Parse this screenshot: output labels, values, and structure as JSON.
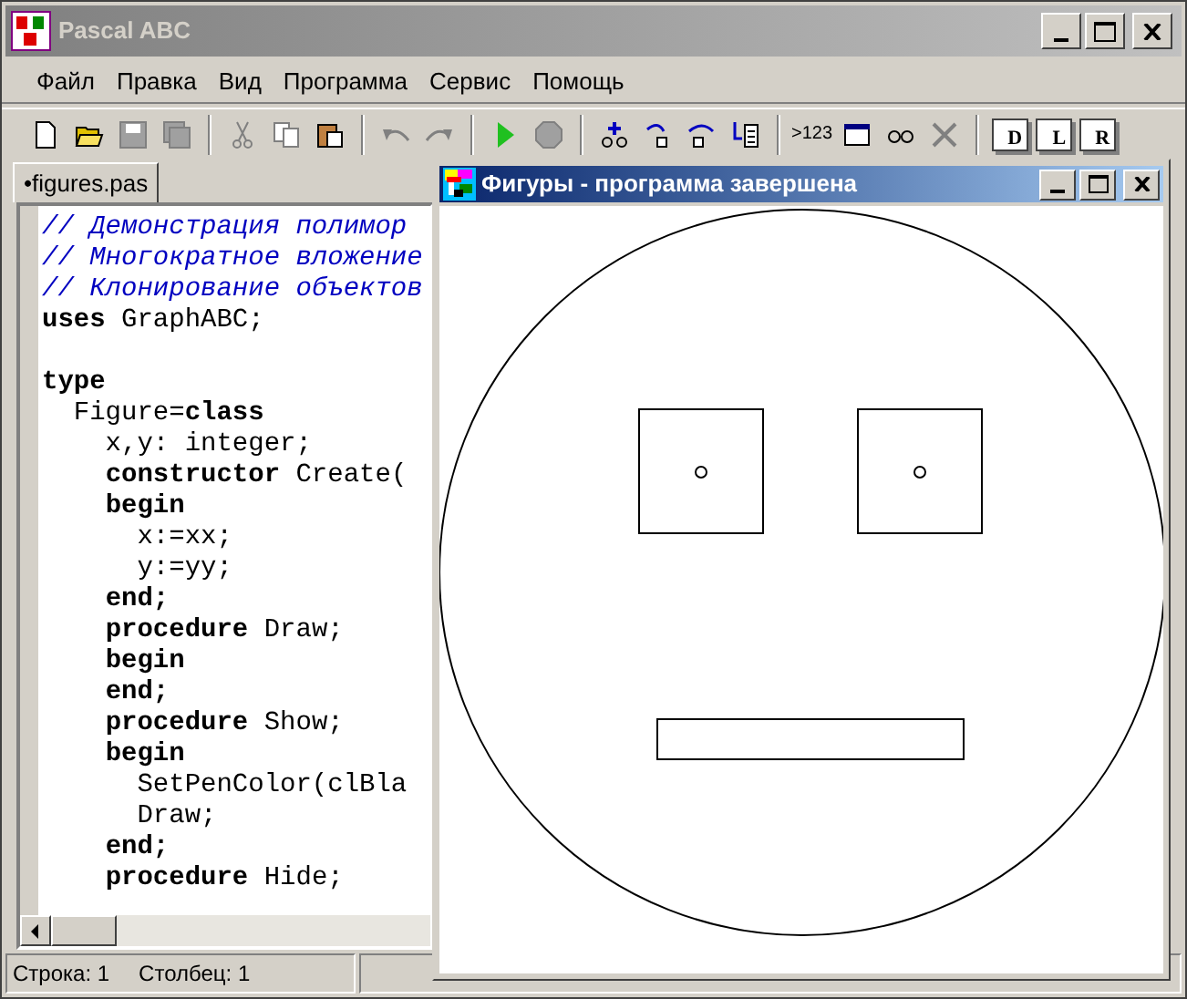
{
  "window": {
    "title": "Pascal ABC"
  },
  "menu": [
    "Файл",
    "Правка",
    "Вид",
    "Программа",
    "Сервис",
    "Помощь"
  ],
  "toolbar": [
    {
      "kind": "new",
      "disabled": false
    },
    {
      "kind": "open",
      "disabled": false
    },
    {
      "kind": "save",
      "disabled": true
    },
    {
      "kind": "save-all",
      "disabled": true
    },
    {
      "kind": "sep"
    },
    {
      "kind": "cut",
      "disabled": true
    },
    {
      "kind": "copy",
      "disabled": true
    },
    {
      "kind": "paste",
      "disabled": false
    },
    {
      "kind": "sep"
    },
    {
      "kind": "undo",
      "disabled": true
    },
    {
      "kind": "redo",
      "disabled": true
    },
    {
      "kind": "sep"
    },
    {
      "kind": "run",
      "disabled": false
    },
    {
      "kind": "stop",
      "disabled": true
    },
    {
      "kind": "sep"
    },
    {
      "kind": "watch-add",
      "disabled": false
    },
    {
      "kind": "step-into",
      "disabled": false
    },
    {
      "kind": "step-over",
      "disabled": false
    },
    {
      "kind": "run-to",
      "disabled": false
    },
    {
      "kind": "sep"
    },
    {
      "kind": "text",
      "label": ">123",
      "disabled": false
    },
    {
      "kind": "window",
      "disabled": false
    },
    {
      "kind": "glasses",
      "disabled": false
    },
    {
      "kind": "delete",
      "disabled": true
    },
    {
      "kind": "sep"
    },
    {
      "kind": "letter-page",
      "label": "D",
      "disabled": false
    },
    {
      "kind": "letter-page",
      "label": "L",
      "disabled": false
    },
    {
      "kind": "letter-page",
      "label": "R",
      "disabled": false
    }
  ],
  "tabs": [
    {
      "label": "•figures.pas",
      "selected": true
    }
  ],
  "editor": {
    "lines": [
      {
        "kind": "comment",
        "text": "// Демонстрация полимор"
      },
      {
        "kind": "comment",
        "text": "// Многократное вложение"
      },
      {
        "kind": "comment",
        "text": "// Клонирование объектов"
      },
      {
        "kind": "code",
        "text": "**uses** GraphABC;"
      },
      {
        "kind": "blank"
      },
      {
        "kind": "code",
        "text": "**type**"
      },
      {
        "kind": "code",
        "text": "  Figure=**class**"
      },
      {
        "kind": "code",
        "text": "    x,y: integer;"
      },
      {
        "kind": "code",
        "text": "    **constructor** Create("
      },
      {
        "kind": "code",
        "text": "    **begin**"
      },
      {
        "kind": "code",
        "text": "      x:=xx;"
      },
      {
        "kind": "code",
        "text": "      y:=yy;"
      },
      {
        "kind": "code",
        "text": "    **end;**"
      },
      {
        "kind": "code",
        "text": "    **procedure** Draw;"
      },
      {
        "kind": "code",
        "text": "    **begin**"
      },
      {
        "kind": "code",
        "text": "    **end;**"
      },
      {
        "kind": "code",
        "text": "    **procedure** Show;"
      },
      {
        "kind": "code",
        "text": "    **begin**"
      },
      {
        "kind": "code",
        "text": "      SetPenColor(clBla"
      },
      {
        "kind": "code",
        "text": "      Draw;"
      },
      {
        "kind": "code",
        "text": "    **end;**"
      },
      {
        "kind": "code",
        "text": "    **procedure** Hide;"
      }
    ]
  },
  "status_bar": [
    "Строка: 1",
    "Столбец: 1"
  ],
  "child_window": {
    "title": "Фигуры - программа завершена"
  }
}
